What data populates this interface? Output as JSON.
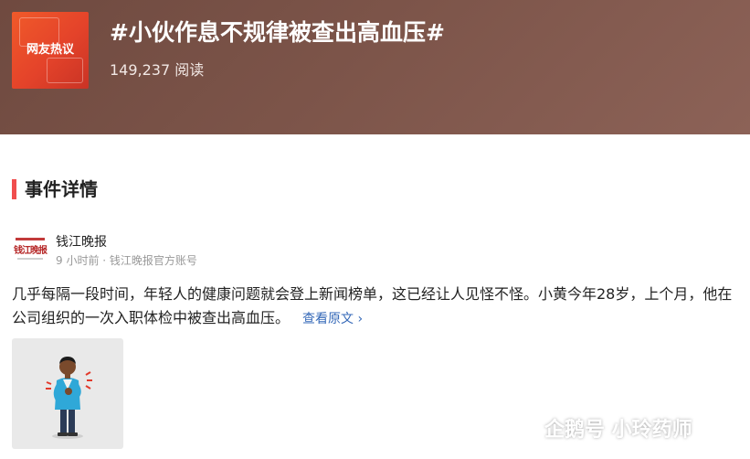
{
  "header": {
    "badge_label": "网友热议",
    "title": "#小伙作息不规律被查出高血压#",
    "reads": "149,237 阅读"
  },
  "section": {
    "title": "事件详情"
  },
  "source": {
    "logo_text": "钱江晚报",
    "name": "钱江晚报",
    "meta": "9 小时前 · 钱江晚报官方账号"
  },
  "article": {
    "text": "几乎每隔一段时间，年轻人的健康问题就会登上新闻榜单，这已经让人见怪不怪。小黄今年28岁，上个月，他在公司组织的一次入职体检中被查出高血压。",
    "read_more": "查看原文 ›"
  },
  "watermark": {
    "text": "企鹅号 小玲药师"
  },
  "colors": {
    "header_bg": "#7c5449",
    "section_accent": "#f04e4e",
    "link": "#3569b8",
    "badge_bg": "#e4432a"
  }
}
